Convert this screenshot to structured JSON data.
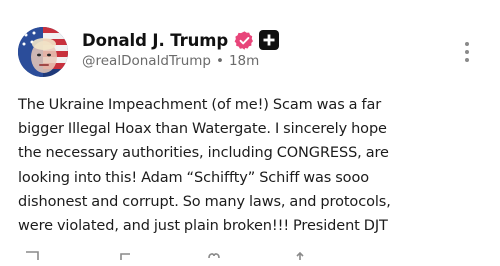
{
  "post": {
    "author": {
      "display_name": "Donald J. Trump",
      "handle": "@realDonaldTrump",
      "separator": "•",
      "time_ago": "18m",
      "verified_icon": "verified-badge-icon",
      "plus_icon": "plus-badge-icon"
    },
    "text_lines": [
      "The Ukraine Impeachment (of me!) Scam was a far",
      "bigger Illegal Hoax than Watergate. I sincerely hope",
      "the necessary authorities, including CONGRESS, are",
      "looking into this! Adam “Schiffty” Schiff was sooo",
      "dishonest and corrupt. So many laws, and protocols,",
      "were violated, and just plain broken!!! President DJT"
    ],
    "more_icon": "more-vertical-icon",
    "actions": [
      "reply-icon",
      "repost-icon",
      "like-icon",
      "share-icon"
    ]
  },
  "colors": {
    "name": "#111111",
    "meta": "#6b6b6b",
    "body_text": "#1c1c1c",
    "verified": "#e8457a",
    "plus_badge": "#111111",
    "icon_gray": "#8a8a8a"
  }
}
